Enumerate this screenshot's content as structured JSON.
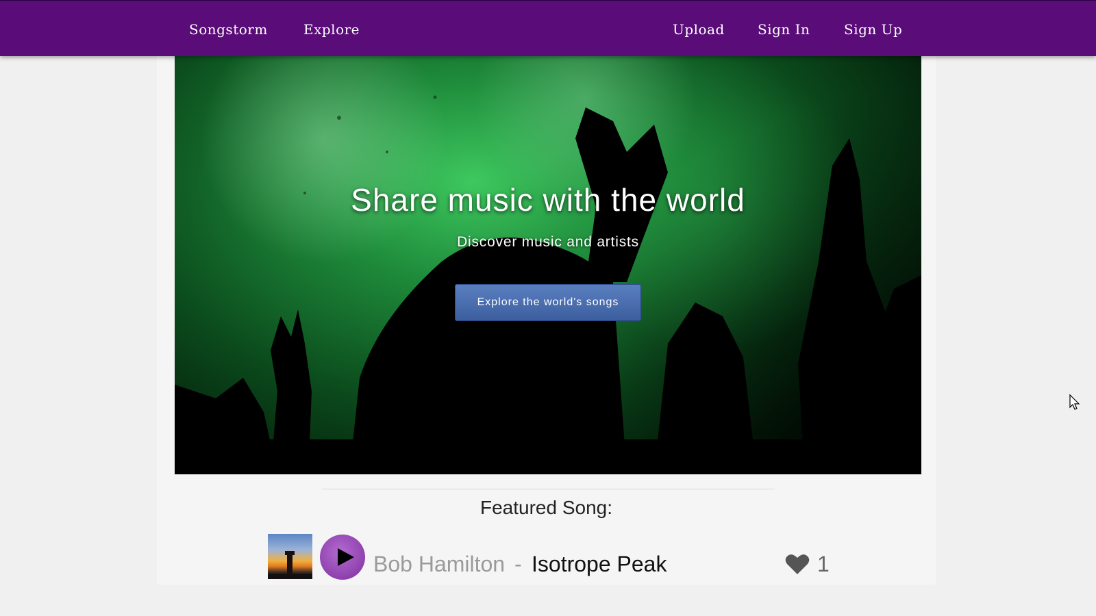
{
  "navbar": {
    "brand": "Songstorm",
    "explore": "Explore",
    "upload": "Upload",
    "sign_in": "Sign In",
    "sign_up": "Sign Up",
    "background_color": "#5a0c78"
  },
  "hero": {
    "title": "Share music with the world",
    "subtitle": "Discover music and artists",
    "button_label": "Explore the world's songs",
    "button_color": "#3c5e9f",
    "image_description_colors": [
      "#3ec85f",
      "#041e0a"
    ]
  },
  "featured": {
    "heading": "Featured Song:",
    "artist": "Bob Hamilton",
    "separator": "-",
    "title": "Isotrope Peak",
    "likes": "1",
    "play_button_color": "#7e2f9e",
    "icons": [
      "album-cover-icon",
      "play-icon",
      "heart-icon"
    ]
  }
}
